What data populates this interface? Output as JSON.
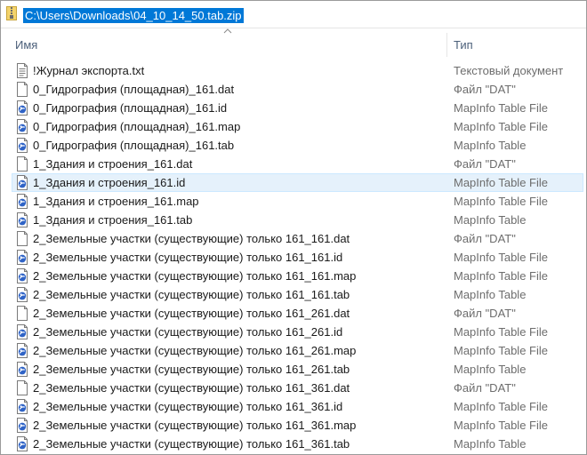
{
  "address_bar": {
    "path": "C:\\Users\\Downloads\\04_10_14_50.tab.zip"
  },
  "columns": {
    "name": "Имя",
    "type": "Тип"
  },
  "files": [
    {
      "name": "!Журнал экспорта.txt",
      "type": "Текстовый документ",
      "icon": "text-document-icon"
    },
    {
      "name": "0_Гидрография (площадная)_161.dat",
      "type": "Файл \"DAT\"",
      "icon": "blank-file-icon"
    },
    {
      "name": "0_Гидрография (площадная)_161.id",
      "type": "MapInfo Table File",
      "icon": "mapinfo-file-icon"
    },
    {
      "name": "0_Гидрография (площадная)_161.map",
      "type": "MapInfo Table File",
      "icon": "mapinfo-file-icon"
    },
    {
      "name": "0_Гидрография (площадная)_161.tab",
      "type": "MapInfo Table",
      "icon": "mapinfo-file-icon"
    },
    {
      "name": "1_Здания и строения_161.dat",
      "type": "Файл \"DAT\"",
      "icon": "blank-file-icon"
    },
    {
      "name": "1_Здания и строения_161.id",
      "type": "MapInfo Table File",
      "icon": "mapinfo-file-icon",
      "selected": true
    },
    {
      "name": "1_Здания и строения_161.map",
      "type": "MapInfo Table File",
      "icon": "mapinfo-file-icon"
    },
    {
      "name": "1_Здания и строения_161.tab",
      "type": "MapInfo Table",
      "icon": "mapinfo-file-icon"
    },
    {
      "name": "2_Земельные участки (существующие) только 161_161.dat",
      "type": "Файл \"DAT\"",
      "icon": "blank-file-icon"
    },
    {
      "name": "2_Земельные участки (существующие) только 161_161.id",
      "type": "MapInfo Table File",
      "icon": "mapinfo-file-icon"
    },
    {
      "name": "2_Земельные участки (существующие) только 161_161.map",
      "type": "MapInfo Table File",
      "icon": "mapinfo-file-icon"
    },
    {
      "name": "2_Земельные участки (существующие) только 161_161.tab",
      "type": "MapInfo Table",
      "icon": "mapinfo-file-icon"
    },
    {
      "name": "2_Земельные участки (существующие) только 161_261.dat",
      "type": "Файл \"DAT\"",
      "icon": "blank-file-icon"
    },
    {
      "name": "2_Земельные участки (существующие) только 161_261.id",
      "type": "MapInfo Table File",
      "icon": "mapinfo-file-icon"
    },
    {
      "name": "2_Земельные участки (существующие) только 161_261.map",
      "type": "MapInfo Table File",
      "icon": "mapinfo-file-icon"
    },
    {
      "name": "2_Земельные участки (существующие) только 161_261.tab",
      "type": "MapInfo Table",
      "icon": "mapinfo-file-icon"
    },
    {
      "name": "2_Земельные участки (существующие) только 161_361.dat",
      "type": "Файл \"DAT\"",
      "icon": "blank-file-icon"
    },
    {
      "name": "2_Земельные участки (существующие) только 161_361.id",
      "type": "MapInfo Table File",
      "icon": "mapinfo-file-icon"
    },
    {
      "name": "2_Земельные участки (существующие) только 161_361.map",
      "type": "MapInfo Table File",
      "icon": "mapinfo-file-icon"
    },
    {
      "name": "2_Земельные участки (существующие) только 161_361.tab",
      "type": "MapInfo Table",
      "icon": "mapinfo-file-icon"
    }
  ]
}
